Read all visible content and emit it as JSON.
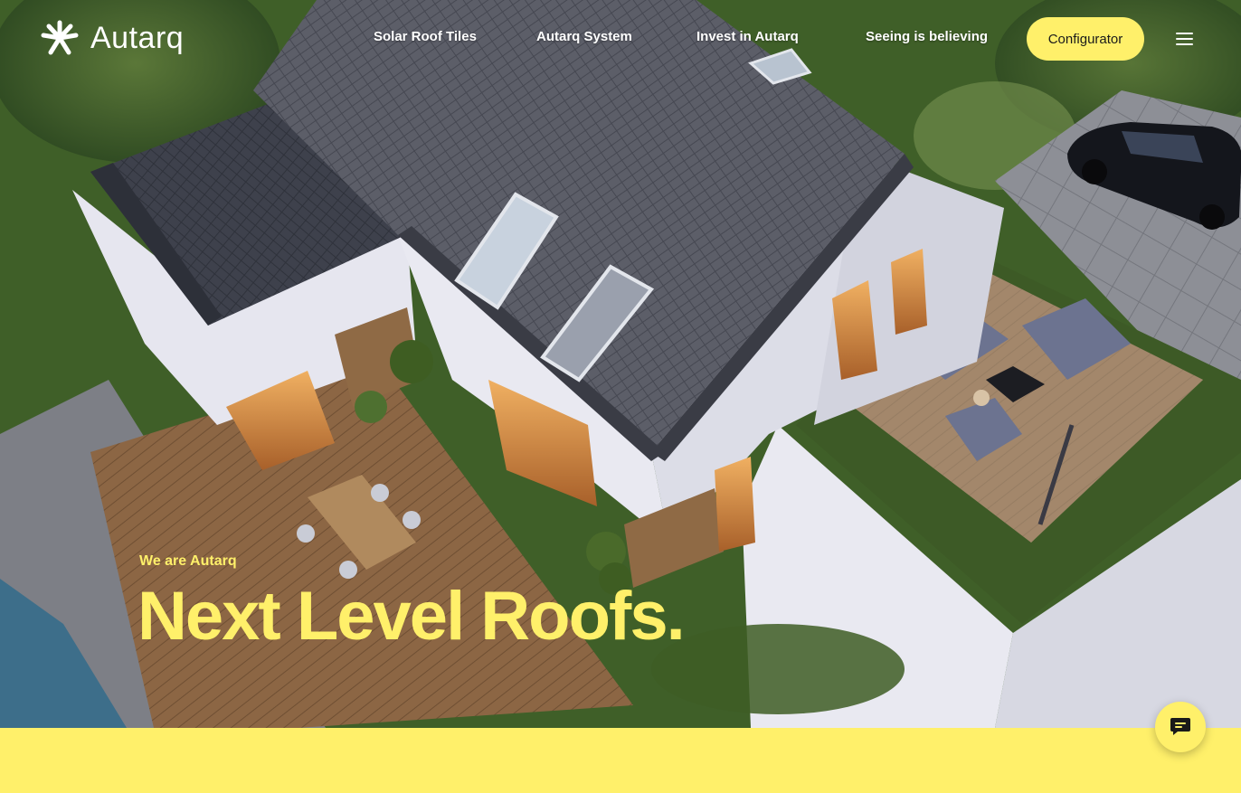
{
  "brand": {
    "name": "Autarq",
    "logo_icon": "sunburst-icon"
  },
  "nav": {
    "items": [
      {
        "label": "Solar Roof Tiles"
      },
      {
        "label": "Autarq System"
      },
      {
        "label": "Invest in Autarq"
      },
      {
        "label": "Seeing is believing"
      }
    ],
    "cta_label": "Configurator",
    "menu_icon": "hamburger-menu-icon"
  },
  "hero": {
    "kicker": "We are Autarq",
    "headline": "Next Level Roofs."
  },
  "chat": {
    "icon": "chat-bubble-icon"
  },
  "colors": {
    "accent": "#fff06a",
    "text_on_accent": "#1a1a1a",
    "nav_text": "#ffffff"
  }
}
